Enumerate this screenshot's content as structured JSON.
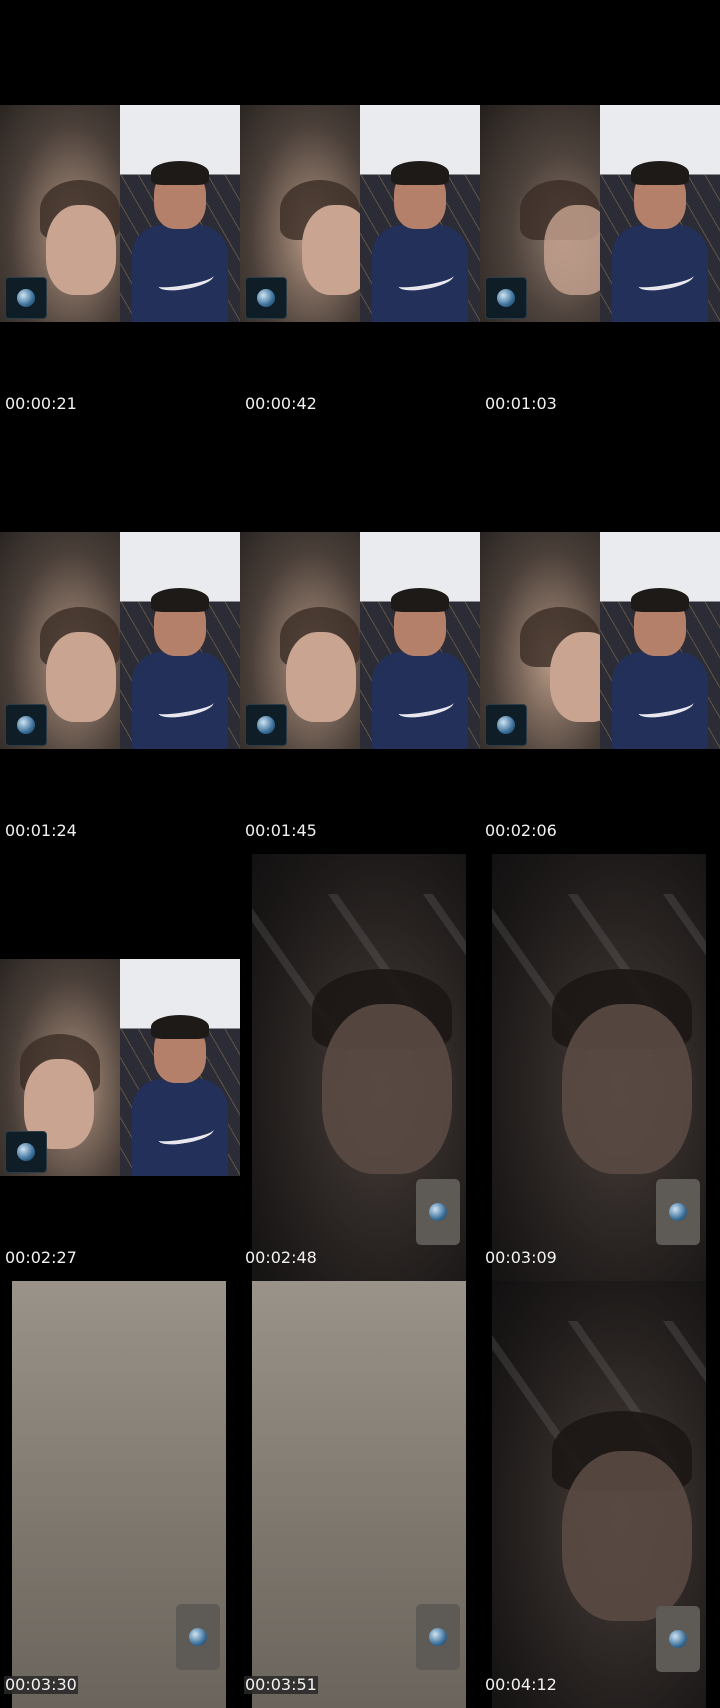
{
  "sheet": {
    "frames": [
      {
        "type": "split",
        "timestamp": "00:00:21"
      },
      {
        "type": "split",
        "timestamp": "00:00:42"
      },
      {
        "type": "split",
        "timestamp": "00:01:03"
      },
      {
        "type": "split",
        "timestamp": "00:01:24"
      },
      {
        "type": "split",
        "timestamp": "00:01:45"
      },
      {
        "type": "split",
        "timestamp": "00:02:06"
      },
      {
        "type": "split",
        "timestamp": "00:02:27"
      },
      {
        "type": "dim",
        "timestamp": "00:02:48"
      },
      {
        "type": "dim",
        "timestamp": "00:03:09"
      },
      {
        "type": "wall",
        "timestamp": "00:03:30"
      },
      {
        "type": "wall",
        "timestamp": "00:03:51"
      },
      {
        "type": "dim",
        "timestamp": "00:04:12"
      }
    ]
  },
  "colors": {
    "background": "#000000",
    "timestamp_text": "#f2f2f2"
  },
  "icons": {
    "pip_avatar": "globe-icon"
  }
}
